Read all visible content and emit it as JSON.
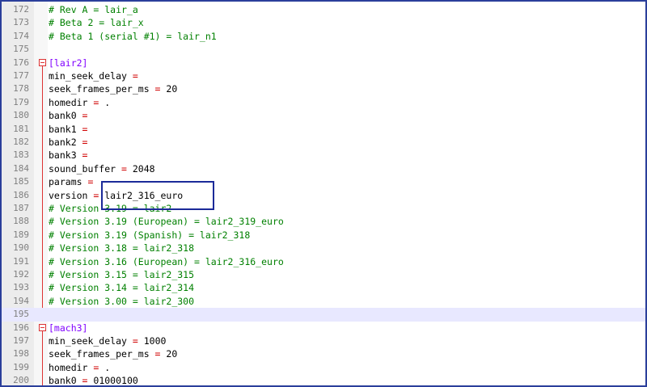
{
  "editor": {
    "highlight_color": "#e8e8ff",
    "lines": [
      {
        "n": "172",
        "kind": "cmt",
        "text": "# Rev A = lair_a"
      },
      {
        "n": "173",
        "kind": "cmt",
        "text": "# Beta 2 = lair_x"
      },
      {
        "n": "174",
        "kind": "cmt",
        "text": "# Beta 1 (serial #1) = lair_n1"
      },
      {
        "n": "175",
        "kind": "blank",
        "text": ""
      },
      {
        "n": "176",
        "kind": "sect",
        "text": "[lair2]"
      },
      {
        "n": "177",
        "kind": "kv",
        "key": "min_seek_delay",
        "value": ""
      },
      {
        "n": "178",
        "kind": "kv",
        "key": "seek_frames_per_ms",
        "value": "20"
      },
      {
        "n": "179",
        "kind": "kv",
        "key": "homedir",
        "value": "."
      },
      {
        "n": "180",
        "kind": "kv",
        "key": "bank0",
        "value": ""
      },
      {
        "n": "181",
        "kind": "kv",
        "key": "bank1",
        "value": ""
      },
      {
        "n": "182",
        "kind": "kv",
        "key": "bank2",
        "value": ""
      },
      {
        "n": "183",
        "kind": "kv",
        "key": "bank3",
        "value": ""
      },
      {
        "n": "184",
        "kind": "kv",
        "key": "sound_buffer",
        "value": "2048"
      },
      {
        "n": "185",
        "kind": "kv",
        "key": "params",
        "value": ""
      },
      {
        "n": "186",
        "kind": "kv",
        "key": "version",
        "value": "lair2_316_euro"
      },
      {
        "n": "187",
        "kind": "cmt",
        "text": "# Version 3.19 = lair2"
      },
      {
        "n": "188",
        "kind": "cmt",
        "text": "# Version 3.19 (European) = lair2_319_euro"
      },
      {
        "n": "189",
        "kind": "cmt",
        "text": "# Version 3.19 (Spanish) = lair2_318"
      },
      {
        "n": "190",
        "kind": "cmt",
        "text": "# Version 3.18 = lair2_318"
      },
      {
        "n": "191",
        "kind": "cmt",
        "text": "# Version 3.16 (European) = lair2_316_euro"
      },
      {
        "n": "192",
        "kind": "cmt",
        "text": "# Version 3.15 = lair2_315"
      },
      {
        "n": "193",
        "kind": "cmt",
        "text": "# Version 3.14 = lair2_314"
      },
      {
        "n": "194",
        "kind": "cmt",
        "text": "# Version 3.00 = lair2_300"
      },
      {
        "n": "195",
        "kind": "blank",
        "text": "",
        "hl": true
      },
      {
        "n": "196",
        "kind": "sect",
        "text": "[mach3]"
      },
      {
        "n": "197",
        "kind": "kv",
        "key": "min_seek_delay",
        "value": "1000"
      },
      {
        "n": "198",
        "kind": "kv",
        "key": "seek_frames_per_ms",
        "value": "20"
      },
      {
        "n": "199",
        "kind": "kv",
        "key": "homedir",
        "value": "."
      },
      {
        "n": "200",
        "kind": "kv",
        "key": "bank0",
        "value": "01000100"
      }
    ]
  }
}
